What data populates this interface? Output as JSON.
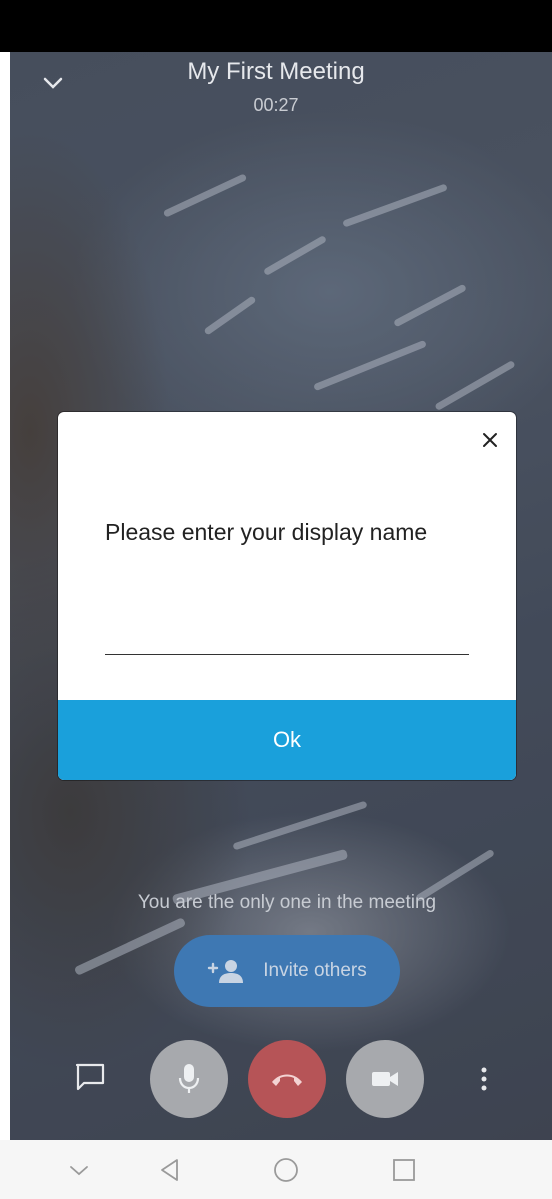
{
  "meeting": {
    "title": "My First Meeting",
    "timer": "00:27"
  },
  "dialog": {
    "prompt": "Please enter your display name",
    "input_value": "",
    "ok_label": "Ok"
  },
  "status_message": "You are the only one in the meeting",
  "invite": {
    "label": "Invite others"
  },
  "toolbar": {
    "icons": [
      "chat-icon",
      "microphone-icon",
      "hangup-icon",
      "camera-icon",
      "more-vertical-icon"
    ]
  },
  "navbar": {
    "icons": [
      "chevron-down-icon",
      "back-icon",
      "home-icon",
      "recents-icon"
    ]
  },
  "colors": {
    "accent": "#1aa0db",
    "hangup": "#b65457",
    "invite": "#3e78b3"
  }
}
